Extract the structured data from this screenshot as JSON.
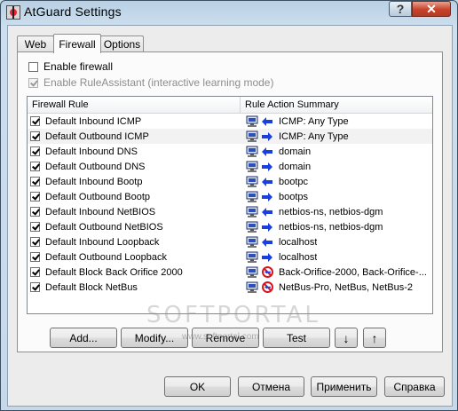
{
  "window": {
    "title": "AtGuard Settings",
    "help_label": "?",
    "close_label": "✕"
  },
  "tabs": [
    {
      "label": "Web",
      "active": false
    },
    {
      "label": "Firewall",
      "active": true
    },
    {
      "label": "Options",
      "active": false
    }
  ],
  "options": {
    "enable_firewall": {
      "label": "Enable firewall",
      "checked": false
    },
    "enable_rule_assistant": {
      "label": "Enable RuleAssistant (interactive learning mode)",
      "checked": true,
      "disabled": true
    }
  },
  "list": {
    "columns": [
      "Firewall Rule",
      "Rule Action Summary"
    ],
    "rows": [
      {
        "name": "Default Inbound ICMP",
        "summary": "ICMP: Any Type",
        "action": "inbound",
        "checked": true
      },
      {
        "name": "Default Outbound ICMP",
        "summary": "ICMP: Any Type",
        "action": "outbound",
        "checked": true
      },
      {
        "name": "Default Inbound DNS",
        "summary": "domain",
        "action": "inbound",
        "checked": true
      },
      {
        "name": "Default Outbound DNS",
        "summary": "domain",
        "action": "outbound",
        "checked": true
      },
      {
        "name": "Default Inbound Bootp",
        "summary": "bootpc",
        "action": "inbound",
        "checked": true
      },
      {
        "name": "Default Outbound Bootp",
        "summary": "bootps",
        "action": "outbound",
        "checked": true
      },
      {
        "name": "Default Inbound NetBIOS",
        "summary": "netbios-ns, netbios-dgm",
        "action": "inbound",
        "checked": true
      },
      {
        "name": "Default Outbound NetBIOS",
        "summary": "netbios-ns, netbios-dgm",
        "action": "outbound",
        "checked": true
      },
      {
        "name": "Default Inbound Loopback",
        "summary": "localhost",
        "action": "inbound",
        "checked": true
      },
      {
        "name": "Default Outbound Loopback",
        "summary": "localhost",
        "action": "outbound",
        "checked": true
      },
      {
        "name": "Default Block Back Orifice 2000",
        "summary": "Back-Orifice-2000, Back-Orifice-...",
        "action": "block",
        "checked": true
      },
      {
        "name": "Default Block NetBus",
        "summary": "NetBus-Pro, NetBus, NetBus-2",
        "action": "block",
        "checked": true
      }
    ]
  },
  "rule_buttons": {
    "add": "Add...",
    "modify": "Modify...",
    "remove": "Remove",
    "test": "Test",
    "move_down": "↓",
    "move_up": "↑"
  },
  "watermark": {
    "text": "SOFTPORTAL",
    "url": "www.softportal.com"
  },
  "dialog_buttons": {
    "ok": "OK",
    "cancel": "Отмена",
    "apply": "Применить",
    "help": "Справка"
  },
  "colors": {
    "arrow": "#1a3fe0",
    "block": "#d8141f",
    "monitor": "#2d4fb8"
  }
}
